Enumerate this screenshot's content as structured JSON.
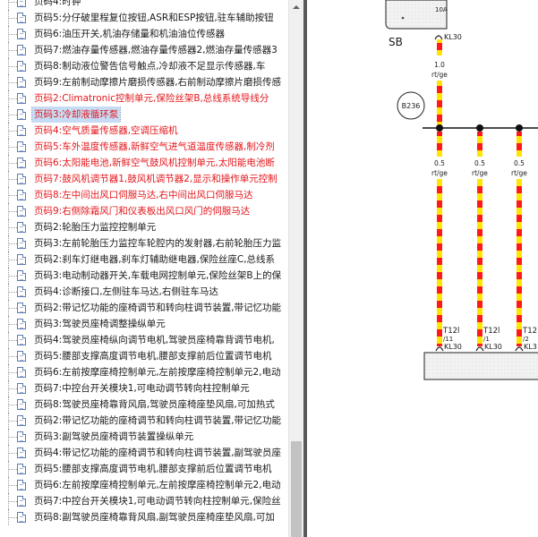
{
  "tree": {
    "items": [
      {
        "label": "页码4:时钟",
        "color": "black"
      },
      {
        "label": "页码5:分仔破里程复位按钮,ASR和ESP按钮,驻车辅助按钮",
        "color": "black"
      },
      {
        "label": "页码6:油压开关,机油存储量和机油油位传感器",
        "color": "black"
      },
      {
        "label": "页码7:燃油存量传感器,燃油存量传感器2,燃油存量传感器3",
        "color": "black"
      },
      {
        "label": "页码8:制动液位警告信号触点,冷却液不足显示传感器,车",
        "color": "black"
      },
      {
        "label": "页码9:左前制动摩擦片磨损传感器,右前制动摩擦片磨损传感",
        "color": "black"
      },
      {
        "label": "页码2:Climatronic控制单元,保险丝架B,总线系统导线分",
        "color": "red"
      },
      {
        "label": "页码3:冷却液循环泵",
        "color": "red",
        "selected": true
      },
      {
        "label": "页码4:空气质量传感器,空调压缩机",
        "color": "red"
      },
      {
        "label": "页码5:车外温度传感器,新鲜空气进气道温度传感器,制冷剂",
        "color": "red"
      },
      {
        "label": "页码6:太阳能电池,新鲜空气鼓风机控制单元,太阳能电池断",
        "color": "red"
      },
      {
        "label": "页码7:鼓风机调节器1,鼓风机调节器2,显示和操作单元控制",
        "color": "red"
      },
      {
        "label": "页码8:左中间出风口伺服马达,右中间出风口伺服马达",
        "color": "red"
      },
      {
        "label": "页码9:右侧除霜风门和仪表板出风口风门的伺服马达",
        "color": "red"
      },
      {
        "label": "页码2:轮胎压力监控控制单元",
        "color": "black"
      },
      {
        "label": "页码3:左前轮胎压力监控车轮腔内的发射器,右前轮胎压力监",
        "color": "black"
      },
      {
        "label": "页码2:刹车灯继电器,刹车灯辅助继电器,保险丝座C,总线系",
        "color": "black"
      },
      {
        "label": "页码3:电动制动器开关,车载电网控制单元,保险丝架B上的保",
        "color": "black"
      },
      {
        "label": "页码4:诊断接口,左侧驻车马达,右侧驻车马达",
        "color": "black"
      },
      {
        "label": "页码2:带记忆功能的座椅调节和转向柱调节装置,带记忆功能",
        "color": "black"
      },
      {
        "label": "页码3:驾驶员座椅调整操纵单元",
        "color": "black"
      },
      {
        "label": "页码4:驾驶员座椅纵向调节电机,驾驶员座椅靠背调节电机,",
        "color": "black"
      },
      {
        "label": "页码5:腰部支撑高度调节电机,腰部支撑前后位置调节电机",
        "color": "black"
      },
      {
        "label": "页码6:左前按摩座椅控制单元,左前按摩座椅控制单元2,电动",
        "color": "black"
      },
      {
        "label": "页码7:中控台开关模块1,可电动调节转向柱控制单元",
        "color": "black"
      },
      {
        "label": "页码8:驾驶员座椅靠背风扇,驾驶员座椅座垫风扇,可加热式",
        "color": "black"
      },
      {
        "label": "页码2:带记忆功能的座椅调节和转向柱调节装置,带记忆功能",
        "color": "black"
      },
      {
        "label": "页码3:副驾驶员座椅调节装置操纵单元",
        "color": "black"
      },
      {
        "label": "页码4:带记忆功能的座椅调节和转向柱调节装置,副驾驶员座",
        "color": "black"
      },
      {
        "label": "页码5:腰部支撑高度调节电机,腰部支撑前后位置调节电机",
        "color": "black"
      },
      {
        "label": "页码6:左前按摩座椅控制单元,左前按摩座椅控制单元2,电动",
        "color": "black"
      },
      {
        "label": "页码7:中控台开关模块1,可电动调节转向柱控制单元,保险丝",
        "color": "black"
      },
      {
        "label": "页码8:副驾驶员座椅靠背风扇,副驾驶员座椅座垫风扇,可加",
        "color": "black"
      }
    ],
    "red_color": "#e4161b"
  },
  "diagram": {
    "sb_label": "SB",
    "sb_top_label": "10A",
    "sb_terminal": "KL30",
    "main_wire": {
      "gauge": "1.0",
      "color_code": "rt/ge"
    },
    "component": "B236",
    "branches": [
      {
        "gauge": "0.5",
        "color_code": "rt/ge",
        "connector": "T12l",
        "pin": "/11",
        "terminal": "KL30"
      },
      {
        "gauge": "0.5",
        "color_code": "rt/ge",
        "connector": "T12l",
        "pin": "/1",
        "terminal": "KL30"
      },
      {
        "gauge": "0.5",
        "color_code": "rt/ge",
        "connector": "T12",
        "pin": "/2",
        "terminal": "KL3"
      }
    ],
    "wire_colors": {
      "red": "#ff1a1a",
      "yellow": "#ffe600"
    }
  }
}
